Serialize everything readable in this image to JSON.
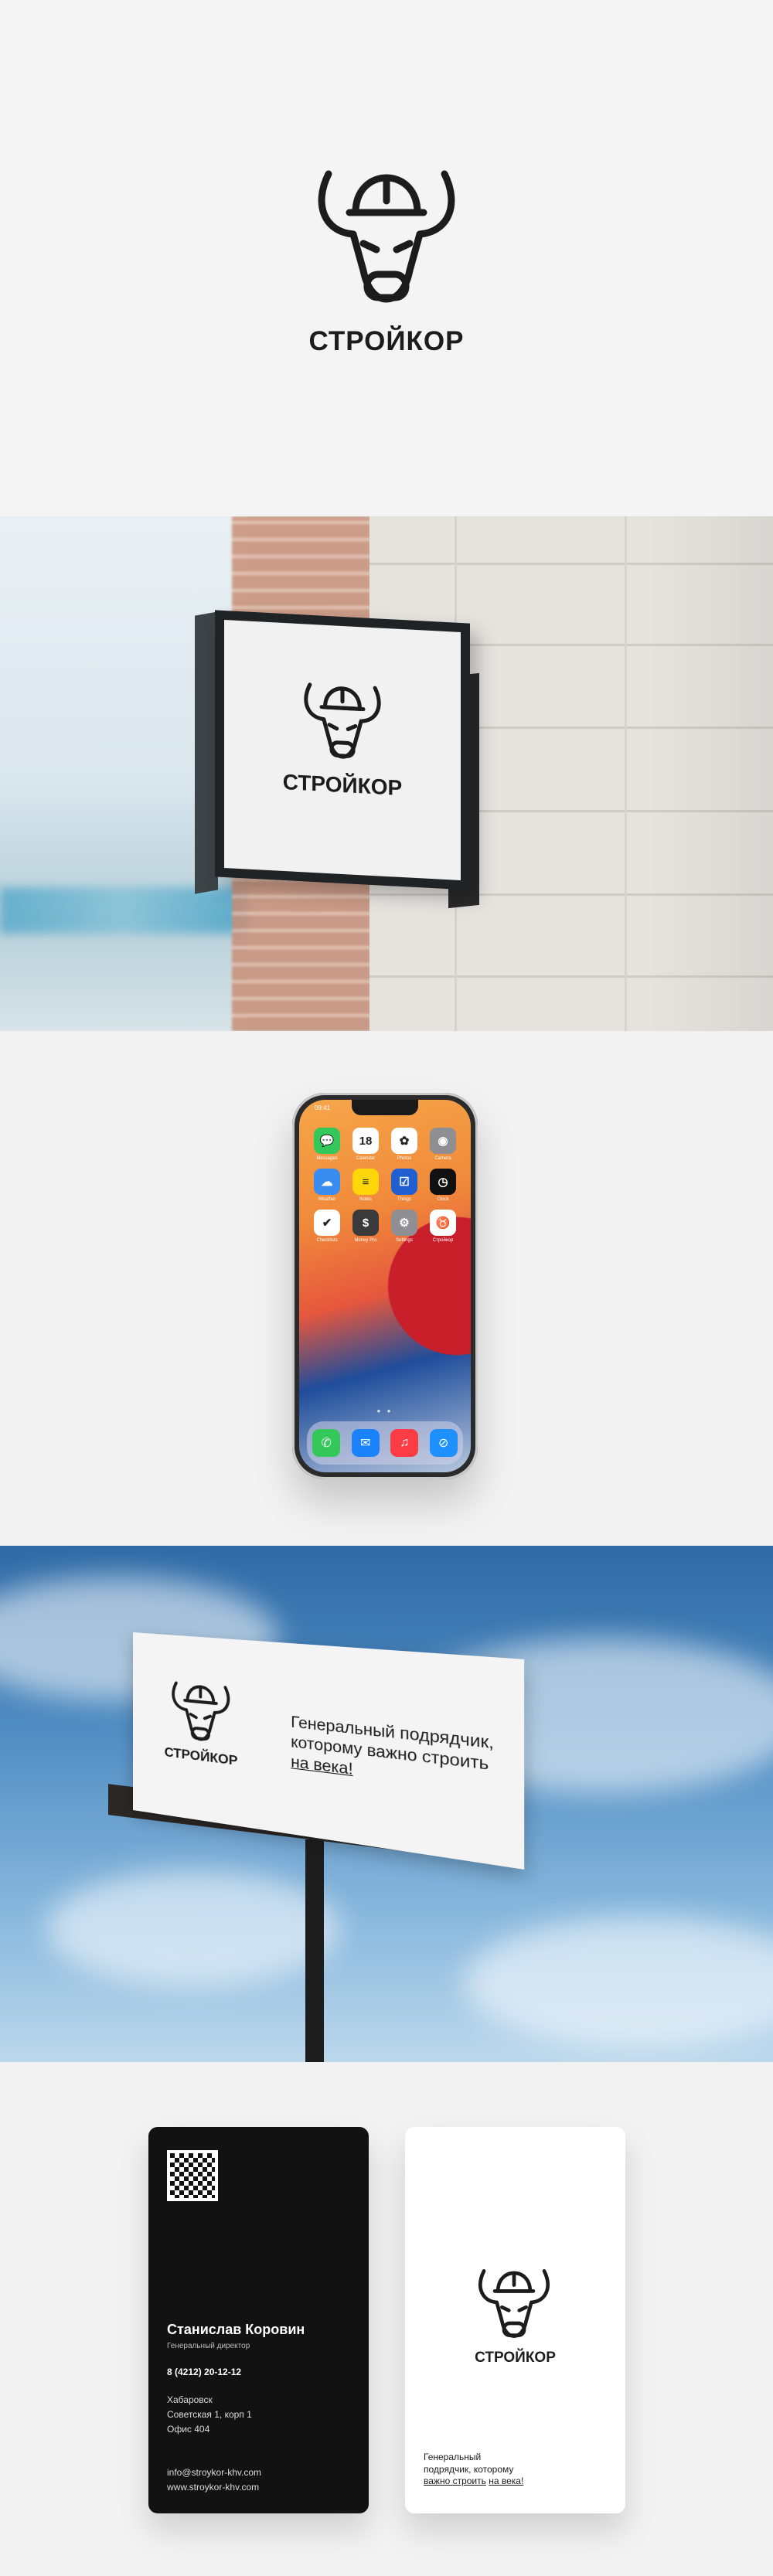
{
  "brand": {
    "name": "СТРОЙКОР",
    "logo_icon": "bull-with-hardhat-icon"
  },
  "phone": {
    "status_time": "09:41",
    "apps": [
      {
        "label": "Messages",
        "icon": "messages-icon",
        "color": "#34c759",
        "glyph": "💬"
      },
      {
        "label": "Calendar",
        "icon": "calendar-icon",
        "color": "#ffffff",
        "glyph": "18"
      },
      {
        "label": "Photos",
        "icon": "photos-icon",
        "color": "#ffffff",
        "glyph": "✿"
      },
      {
        "label": "Camera",
        "icon": "camera-icon",
        "color": "#8e8e93",
        "glyph": "◉"
      },
      {
        "label": "Weather",
        "icon": "weather-icon",
        "color": "#3a8df0",
        "glyph": "☁"
      },
      {
        "label": "Notes",
        "icon": "notes-icon",
        "color": "#ffd60a",
        "glyph": "≡"
      },
      {
        "label": "Things",
        "icon": "things-icon",
        "color": "#1f5fd1",
        "glyph": "☑"
      },
      {
        "label": "Clock",
        "icon": "clock-icon",
        "color": "#111111",
        "glyph": "◷"
      },
      {
        "label": "Checklists",
        "icon": "checklists-icon",
        "color": "#ffffff",
        "glyph": "✔"
      },
      {
        "label": "Money Pro",
        "icon": "money-icon",
        "color": "#3a3a3c",
        "glyph": "$"
      },
      {
        "label": "Settings",
        "icon": "settings-icon",
        "color": "#8e8e93",
        "glyph": "⚙"
      },
      {
        "label": "Стройкор",
        "icon": "bull-app-icon",
        "color": "#ffffff",
        "glyph": "♉"
      }
    ],
    "page_dots": "● ●",
    "dock": [
      {
        "icon": "phone-icon",
        "color": "#34c759",
        "glyph": "✆"
      },
      {
        "icon": "mail-icon",
        "color": "#1a82fb",
        "glyph": "✉"
      },
      {
        "icon": "music-icon",
        "color": "#fc3c44",
        "glyph": "♫"
      },
      {
        "icon": "safari-icon",
        "color": "#1e90ff",
        "glyph": "⊘"
      }
    ]
  },
  "billboard": {
    "slogan_line1": "Генеральный подрядчик,",
    "slogan_line2": "которому важно строить",
    "slogan_underlined": "на века!"
  },
  "business_card": {
    "name": "Станислав Коровин",
    "position": "Генеральный директор",
    "phone": "8 (4212) 20-12-12",
    "address_line1": "Хабаровск",
    "address_line2": "Советская 1, корп 1",
    "address_line3": "Офис 404",
    "email": "info@stroykor-khv.com",
    "website": "www.stroykor-khv.com",
    "qr_icon": "qr-code-icon",
    "slogan_line1": "Генеральный",
    "slogan_line2": "подрядчик, которому",
    "slogan_line3": "важно строить",
    "slogan_underlined": "на века!"
  }
}
